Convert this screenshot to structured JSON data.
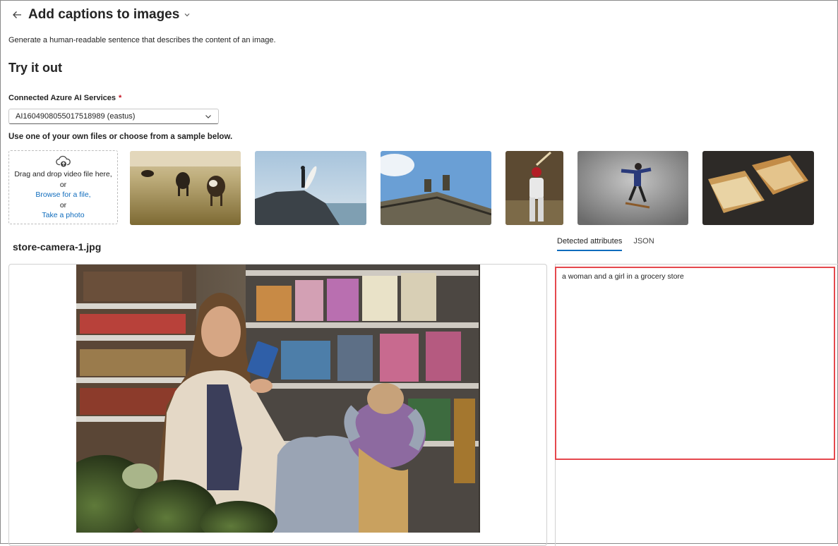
{
  "header": {
    "title": "Add captions to images"
  },
  "description": "Generate a human-readable sentence that describes the content of an image.",
  "section_title": "Try it out",
  "service": {
    "label": "Connected Azure AI Services",
    "required_mark": "*",
    "selected": "AI1604908055017518989 (eastus)"
  },
  "hint": "Use one of your own files or choose from a sample below.",
  "upload": {
    "line1": "Drag and drop video file here,",
    "or1": "or",
    "browse": "Browse for a file,",
    "or2": "or",
    "photo": "Take a photo"
  },
  "samples": [
    "cows-in-field",
    "surfer-on-rock",
    "building-statues",
    "baseball-batter",
    "skateboarder",
    "grilled-sandwich"
  ],
  "file_name": "store-camera-1.jpg",
  "tabs": [
    "Detected attributes",
    "JSON"
  ],
  "caption": "a woman and a girl in a grocery store",
  "colors": {
    "accent": "#0f6cbd",
    "highlight": "#e5484d",
    "required": "#c50f1f"
  }
}
